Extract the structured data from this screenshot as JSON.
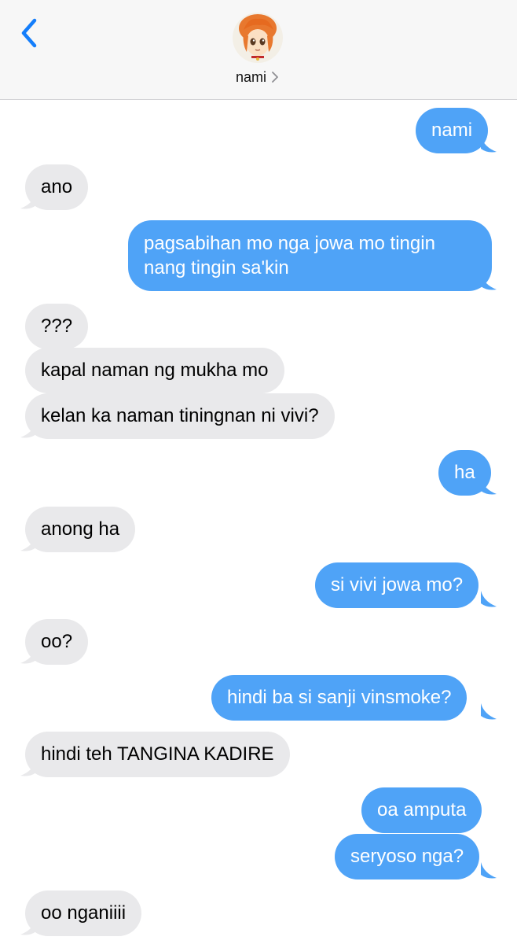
{
  "header": {
    "contact_name": "nami"
  },
  "colors": {
    "sent_bubble": "#4fa3f7",
    "received_bubble": "#e9e9eb",
    "accent": "#147efb"
  },
  "messages": [
    {
      "sender": "me",
      "text": "nami"
    },
    {
      "sender": "them",
      "text": "ano"
    },
    {
      "sender": "me",
      "text": "pagsabihan mo nga jowa mo tingin nang tingin sa'kin"
    },
    {
      "sender": "them",
      "text": "???"
    },
    {
      "sender": "them",
      "text": "kapal naman ng mukha mo"
    },
    {
      "sender": "them",
      "text": "kelan ka naman tiningnan ni vivi?"
    },
    {
      "sender": "me",
      "text": "ha"
    },
    {
      "sender": "them",
      "text": "anong ha"
    },
    {
      "sender": "me",
      "text": "si vivi jowa mo?"
    },
    {
      "sender": "them",
      "text": "oo?"
    },
    {
      "sender": "me",
      "text": "hindi ba si sanji vinsmoke?"
    },
    {
      "sender": "them",
      "text": "hindi teh TANGINA KADIRE"
    },
    {
      "sender": "me",
      "text": "oa amputa"
    },
    {
      "sender": "me",
      "text": "seryoso nga?"
    },
    {
      "sender": "them",
      "text": "oo nganiiii"
    }
  ]
}
